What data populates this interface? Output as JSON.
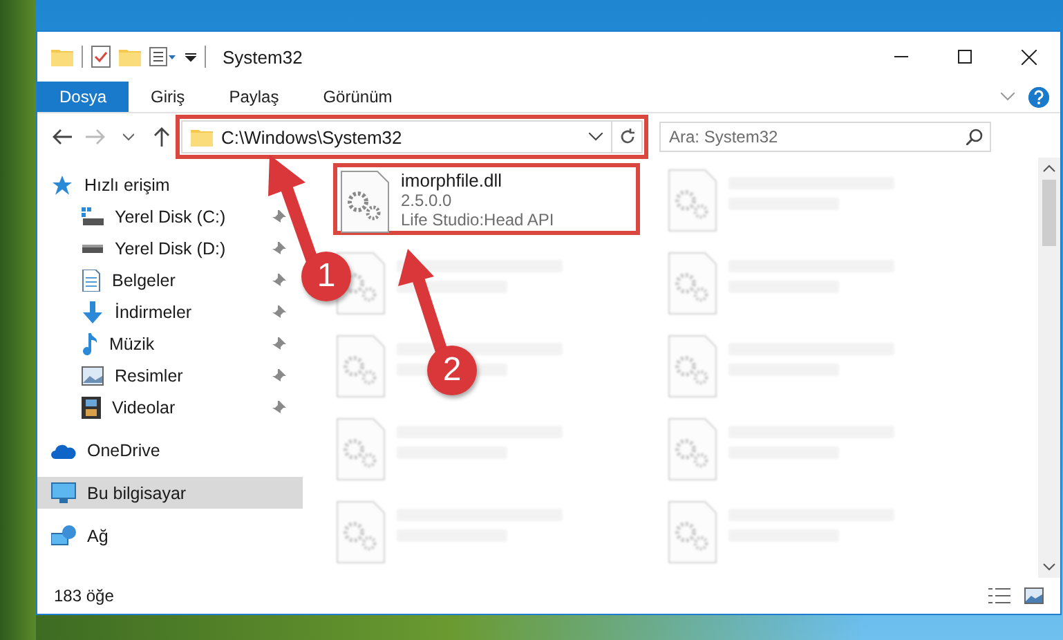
{
  "window": {
    "title": "System32"
  },
  "ribbon_tabs": [
    {
      "label": "Dosya",
      "selected": true
    },
    {
      "label": "Giriş",
      "selected": false
    },
    {
      "label": "Paylaş",
      "selected": false
    },
    {
      "label": "Görünüm",
      "selected": false
    }
  ],
  "address_bar": {
    "path": "C:\\Windows\\System32"
  },
  "search": {
    "placeholder": "Ara: System32"
  },
  "nav_pane": [
    {
      "label": "Hızlı erişim",
      "kind": "star",
      "pinned": false,
      "selected": false,
      "children": [
        {
          "label": "Yerel Disk (C:)",
          "kind": "drive-c",
          "pinned": true,
          "selected": false
        },
        {
          "label": "Yerel Disk (D:)",
          "kind": "drive",
          "pinned": true,
          "selected": false
        },
        {
          "label": "Belgeler",
          "kind": "document",
          "pinned": true,
          "selected": false
        },
        {
          "label": "İndirmeler",
          "kind": "download",
          "pinned": true,
          "selected": false
        },
        {
          "label": "Müzik",
          "kind": "music",
          "pinned": true,
          "selected": false
        },
        {
          "label": "Resimler",
          "kind": "picture",
          "pinned": true,
          "selected": false
        },
        {
          "label": "Videolar",
          "kind": "video",
          "pinned": true,
          "selected": false
        }
      ]
    },
    {
      "label": "OneDrive",
      "kind": "cloud",
      "pinned": false,
      "selected": false
    },
    {
      "label": "Bu bilgisayar",
      "kind": "computer",
      "pinned": false,
      "selected": true
    },
    {
      "label": "Ağ",
      "kind": "network",
      "pinned": false,
      "selected": false
    }
  ],
  "files": [
    {
      "name": "imorphfile.dll",
      "details": [
        "2.5.0.0",
        "Life Studio:Head API"
      ],
      "faded": false,
      "highlighted": true
    },
    {
      "faded": true
    },
    {
      "faded": true
    },
    {
      "faded": true
    },
    {
      "faded": true
    },
    {
      "faded": true
    },
    {
      "faded": true
    },
    {
      "faded": true
    },
    {
      "faded": true
    },
    {
      "faded": true
    }
  ],
  "address_highlighted": true,
  "callouts": [
    {
      "number": "1"
    },
    {
      "number": "2"
    }
  ],
  "status_bar": {
    "item_count": "183 öğe"
  }
}
